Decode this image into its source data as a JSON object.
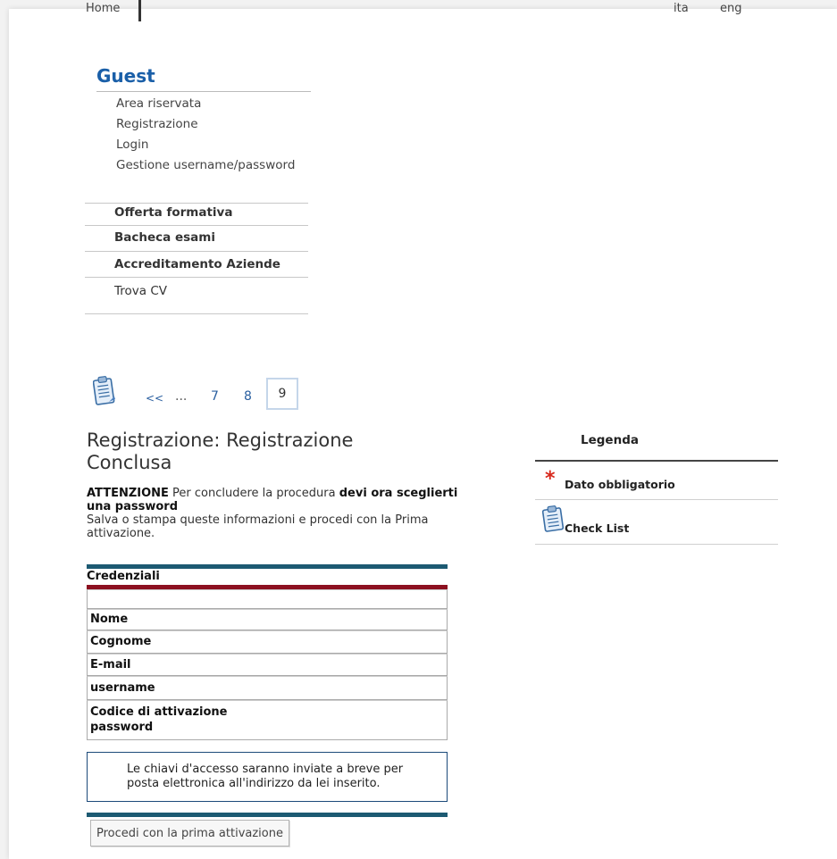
{
  "topnav": {
    "home_label": "Home",
    "languages": [
      "ita",
      "eng"
    ]
  },
  "guest": {
    "title": "Guest",
    "items": [
      {
        "label": "Area riservata"
      },
      {
        "label": "Registrazione"
      },
      {
        "label": "Login"
      },
      {
        "label": "Gestione username/password"
      }
    ]
  },
  "menu": {
    "items": [
      {
        "label": "Offerta formativa"
      },
      {
        "label": "Bacheca esami"
      },
      {
        "label": "Accreditamento Aziende"
      },
      {
        "label": "Trova CV"
      }
    ]
  },
  "pager": {
    "icon": "checklist-icon",
    "first_label": "<<",
    "ellipsis": "...",
    "pages": [
      "7",
      "8"
    ],
    "current": "9"
  },
  "main": {
    "title": "Registrazione: Registrazione Conclusa",
    "attention_label": "ATTENZIONE",
    "attention_text": " Per concludere la procedura ",
    "attention_bold": "devi ora sceglierti una password",
    "instruction": "Salva o stampa queste informazioni e procedi con la Prima attivazione.",
    "credentials": {
      "section_label": "Credenziali",
      "fields": [
        {
          "label": "Nome"
        },
        {
          "label": "Cognome"
        },
        {
          "label": "E-mail"
        },
        {
          "label": "username"
        }
      ],
      "activation_code_label": "Codice di attivazione",
      "password_label": "password"
    },
    "info_message": "Le chiavi d'accesso saranno inviate a breve per posta elettronica all'indirizzo da lei inserito.",
    "proceed_button": "Procedi con la prima attivazione"
  },
  "legend": {
    "title": "Legenda",
    "required_symbol": "*",
    "required_label": "Dato obbligatorio",
    "checklist_label": "Check List"
  },
  "colors": {
    "brand_blue": "#1a5fa8",
    "teal_bar": "#1c5a72",
    "red_bar": "#8c1020",
    "required_star": "#d8281c"
  }
}
